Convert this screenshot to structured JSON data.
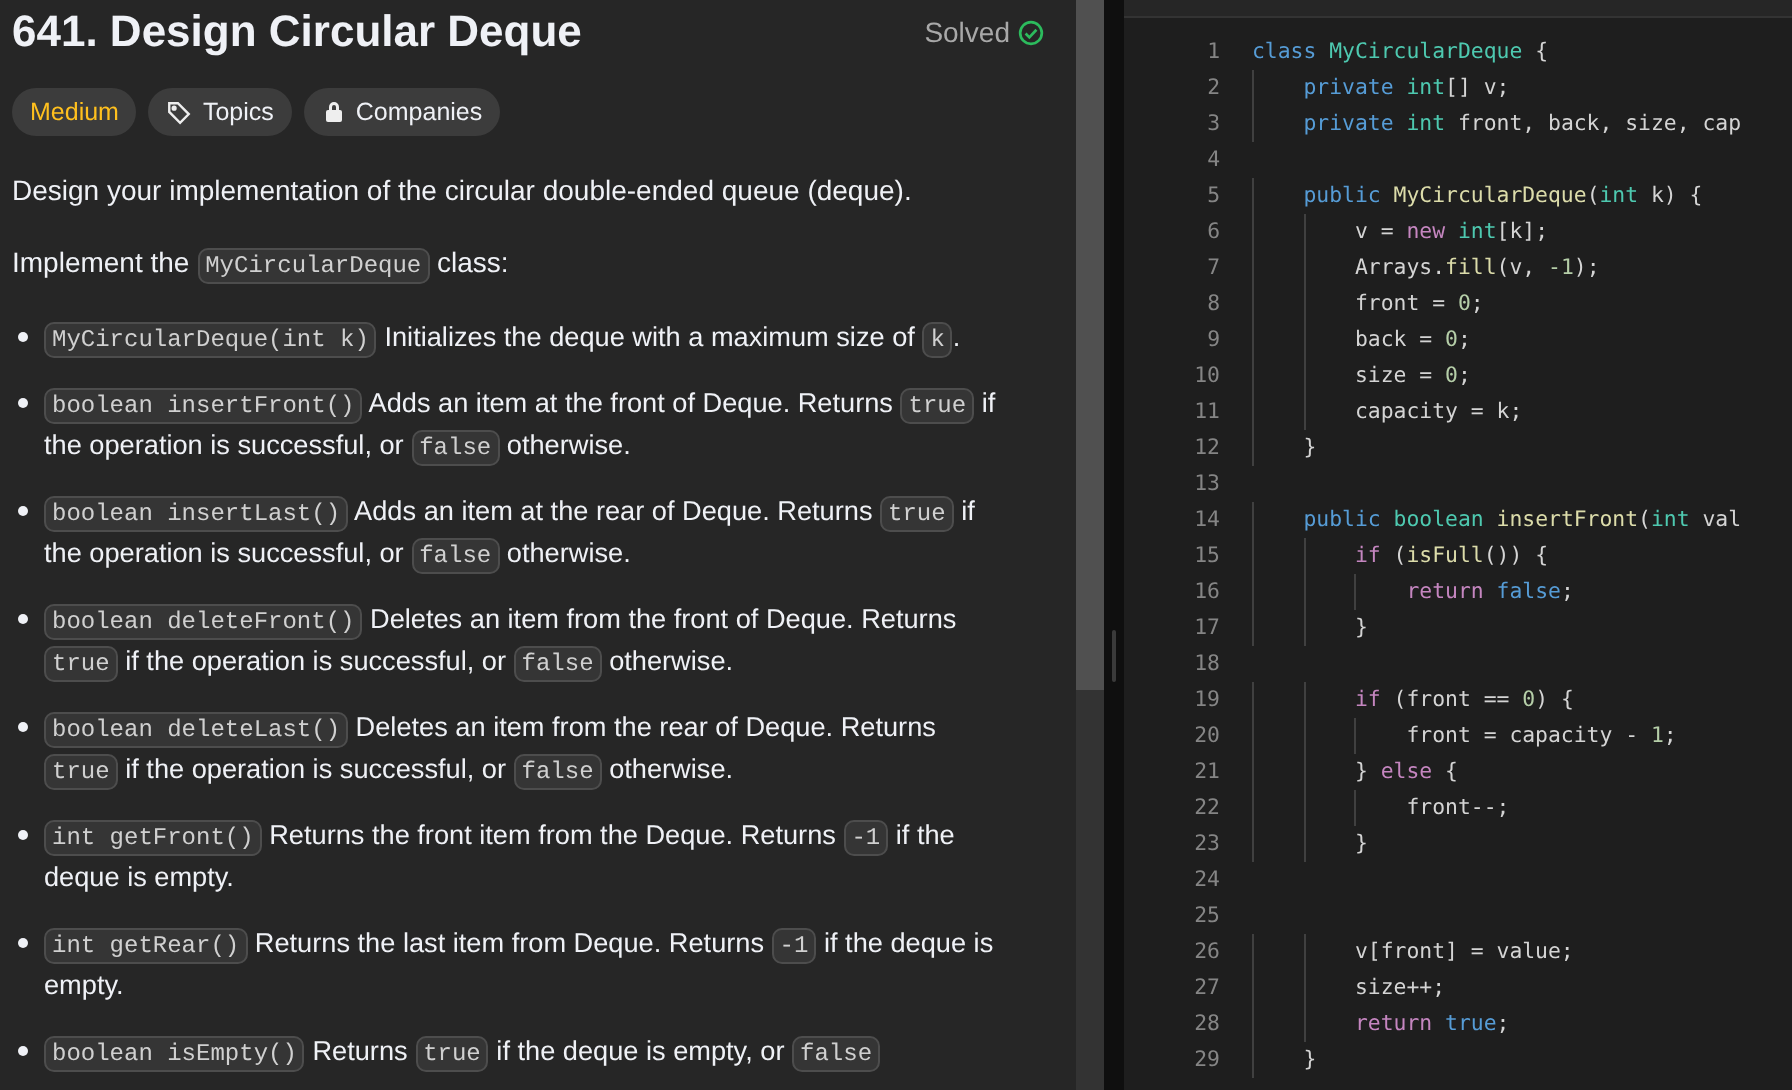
{
  "problem": {
    "title": "641. Design Circular Deque",
    "status": "Solved",
    "tags": [
      {
        "kind": "difficulty",
        "label": "Medium"
      },
      {
        "kind": "topics",
        "label": "Topics"
      },
      {
        "kind": "companies",
        "label": "Companies"
      }
    ],
    "paragraphs": [
      [
        {
          "kind": "text",
          "text": "Design your implementation of the circular double-ended queue (deque)."
        }
      ],
      [
        {
          "kind": "text",
          "text": "Implement the "
        },
        {
          "kind": "code",
          "text": "MyCircularDeque"
        },
        {
          "kind": "text",
          "text": " class:"
        }
      ]
    ],
    "bullets": [
      [
        {
          "kind": "code",
          "text": "MyCircularDeque(int k)"
        },
        {
          "kind": "text",
          "text": " Initializes the deque with a maximum size of "
        },
        {
          "kind": "code",
          "text": "k"
        },
        {
          "kind": "text",
          "text": "."
        }
      ],
      [
        {
          "kind": "code",
          "text": "boolean insertFront()"
        },
        {
          "kind": "text",
          "text": " Adds an item at the front of Deque. Returns "
        },
        {
          "kind": "code",
          "text": "true"
        },
        {
          "kind": "text",
          "text": " if the operation is successful, or "
        },
        {
          "kind": "code",
          "text": "false"
        },
        {
          "kind": "text",
          "text": " otherwise."
        }
      ],
      [
        {
          "kind": "code",
          "text": "boolean insertLast()"
        },
        {
          "kind": "text",
          "text": " Adds an item at the rear of Deque. Returns "
        },
        {
          "kind": "code",
          "text": "true"
        },
        {
          "kind": "text",
          "text": " if the operation is successful, or "
        },
        {
          "kind": "code",
          "text": "false"
        },
        {
          "kind": "text",
          "text": " otherwise."
        }
      ],
      [
        {
          "kind": "code",
          "text": "boolean deleteFront()"
        },
        {
          "kind": "text",
          "text": " Deletes an item from the front of Deque. Returns "
        },
        {
          "kind": "code",
          "text": "true"
        },
        {
          "kind": "text",
          "text": " if the operation is successful, or "
        },
        {
          "kind": "code",
          "text": "false"
        },
        {
          "kind": "text",
          "text": " otherwise."
        }
      ],
      [
        {
          "kind": "code",
          "text": "boolean deleteLast()"
        },
        {
          "kind": "text",
          "text": " Deletes an item from the rear of Deque. Returns "
        },
        {
          "kind": "code",
          "text": "true"
        },
        {
          "kind": "text",
          "text": " if the operation is successful, or "
        },
        {
          "kind": "code",
          "text": "false"
        },
        {
          "kind": "text",
          "text": " otherwise."
        }
      ],
      [
        {
          "kind": "code",
          "text": "int getFront()"
        },
        {
          "kind": "text",
          "text": " Returns the front item from the Deque. Returns "
        },
        {
          "kind": "code",
          "text": "-1"
        },
        {
          "kind": "text",
          "text": " if the deque is empty."
        }
      ],
      [
        {
          "kind": "code",
          "text": "int getRear()"
        },
        {
          "kind": "text",
          "text": " Returns the last item from Deque. Returns "
        },
        {
          "kind": "code",
          "text": "-1"
        },
        {
          "kind": "text",
          "text": " if the deque is empty."
        }
      ],
      [
        {
          "kind": "code",
          "text": "boolean isEmpty()"
        },
        {
          "kind": "text",
          "text": " Returns "
        },
        {
          "kind": "code",
          "text": "true"
        },
        {
          "kind": "text",
          "text": " if the deque is empty, or "
        },
        {
          "kind": "code",
          "text": "false"
        }
      ]
    ]
  },
  "editor": {
    "lines": [
      {
        "number": "1",
        "tokens": [
          {
            "kind": "kw",
            "text": "class "
          },
          {
            "kind": "type",
            "text": "MyCircularDeque"
          },
          {
            "kind": "plain",
            "text": " {"
          }
        ]
      },
      {
        "number": "2",
        "tokens": [
          {
            "kind": "kw",
            "text": "    private "
          },
          {
            "kind": "type",
            "text": "int"
          },
          {
            "kind": "plain",
            "text": "[] v;"
          }
        ]
      },
      {
        "number": "3",
        "tokens": [
          {
            "kind": "kw",
            "text": "    private "
          },
          {
            "kind": "type",
            "text": "int"
          },
          {
            "kind": "plain",
            "text": " front, back, size, cap"
          }
        ]
      },
      {
        "number": "4"
      },
      {
        "number": "5",
        "tokens": [
          {
            "kind": "kw",
            "text": "    public "
          },
          {
            "kind": "fn",
            "text": "MyCircularDeque"
          },
          {
            "kind": "plain",
            "text": "("
          },
          {
            "kind": "type",
            "text": "int"
          },
          {
            "kind": "plain",
            "text": " k) {"
          }
        ]
      },
      {
        "number": "6",
        "tokens": [
          {
            "kind": "plain",
            "text": "        v = "
          },
          {
            "kind": "ctl",
            "text": "new "
          },
          {
            "kind": "type",
            "text": "int"
          },
          {
            "kind": "plain",
            "text": "[k];"
          }
        ]
      },
      {
        "number": "7",
        "tokens": [
          {
            "kind": "plain",
            "text": "        Arrays."
          },
          {
            "kind": "fn",
            "text": "fill"
          },
          {
            "kind": "plain",
            "text": "(v, "
          },
          {
            "kind": "num",
            "text": "-1"
          },
          {
            "kind": "plain",
            "text": ");"
          }
        ]
      },
      {
        "number": "8",
        "tokens": [
          {
            "kind": "plain",
            "text": "        front = "
          },
          {
            "kind": "num",
            "text": "0"
          },
          {
            "kind": "plain",
            "text": ";"
          }
        ]
      },
      {
        "number": "9",
        "tokens": [
          {
            "kind": "plain",
            "text": "        back = "
          },
          {
            "kind": "num",
            "text": "0"
          },
          {
            "kind": "plain",
            "text": ";"
          }
        ]
      },
      {
        "number": "10",
        "tokens": [
          {
            "kind": "plain",
            "text": "        size = "
          },
          {
            "kind": "num",
            "text": "0"
          },
          {
            "kind": "plain",
            "text": ";"
          }
        ]
      },
      {
        "number": "11",
        "tokens": [
          {
            "kind": "plain",
            "text": "        capacity = k;"
          }
        ]
      },
      {
        "number": "12",
        "tokens": [
          {
            "kind": "plain",
            "text": "    }"
          }
        ]
      },
      {
        "number": "13"
      },
      {
        "number": "14",
        "tokens": [
          {
            "kind": "kw",
            "text": "    public "
          },
          {
            "kind": "type",
            "text": "boolean "
          },
          {
            "kind": "fn",
            "text": "insertFront"
          },
          {
            "kind": "plain",
            "text": "("
          },
          {
            "kind": "type",
            "text": "int"
          },
          {
            "kind": "plain",
            "text": " val"
          }
        ]
      },
      {
        "number": "15",
        "tokens": [
          {
            "kind": "ctl",
            "text": "        if"
          },
          {
            "kind": "plain",
            "text": " ("
          },
          {
            "kind": "fn",
            "text": "isFull"
          },
          {
            "kind": "plain",
            "text": "()) {"
          }
        ]
      },
      {
        "number": "16",
        "tokens": [
          {
            "kind": "ctl",
            "text": "            return "
          },
          {
            "kind": "kw",
            "text": "false"
          },
          {
            "kind": "plain",
            "text": ";"
          }
        ]
      },
      {
        "number": "17",
        "tokens": [
          {
            "kind": "plain",
            "text": "        }"
          }
        ]
      },
      {
        "number": "18"
      },
      {
        "number": "19",
        "tokens": [
          {
            "kind": "ctl",
            "text": "        if"
          },
          {
            "kind": "plain",
            "text": " (front == "
          },
          {
            "kind": "num",
            "text": "0"
          },
          {
            "kind": "plain",
            "text": ") {"
          }
        ]
      },
      {
        "number": "20",
        "tokens": [
          {
            "kind": "plain",
            "text": "            front = capacity - "
          },
          {
            "kind": "num",
            "text": "1"
          },
          {
            "kind": "plain",
            "text": ";"
          }
        ]
      },
      {
        "number": "21",
        "tokens": [
          {
            "kind": "plain",
            "text": "        } "
          },
          {
            "kind": "ctl",
            "text": "else"
          },
          {
            "kind": "plain",
            "text": " {"
          }
        ]
      },
      {
        "number": "22",
        "tokens": [
          {
            "kind": "plain",
            "text": "            front--;"
          }
        ]
      },
      {
        "number": "23",
        "tokens": [
          {
            "kind": "plain",
            "text": "        }"
          }
        ]
      },
      {
        "number": "24"
      },
      {
        "number": "25"
      },
      {
        "number": "26",
        "tokens": [
          {
            "kind": "plain",
            "text": "        v[front] = value;"
          }
        ]
      },
      {
        "number": "27",
        "tokens": [
          {
            "kind": "plain",
            "text": "        size++;"
          }
        ]
      },
      {
        "number": "28",
        "tokens": [
          {
            "kind": "ctl",
            "text": "        return "
          },
          {
            "kind": "kw",
            "text": "true"
          },
          {
            "kind": "plain",
            "text": ";"
          }
        ]
      },
      {
        "number": "29",
        "tokens": [
          {
            "kind": "plain",
            "text": "    }"
          }
        ]
      }
    ]
  }
}
